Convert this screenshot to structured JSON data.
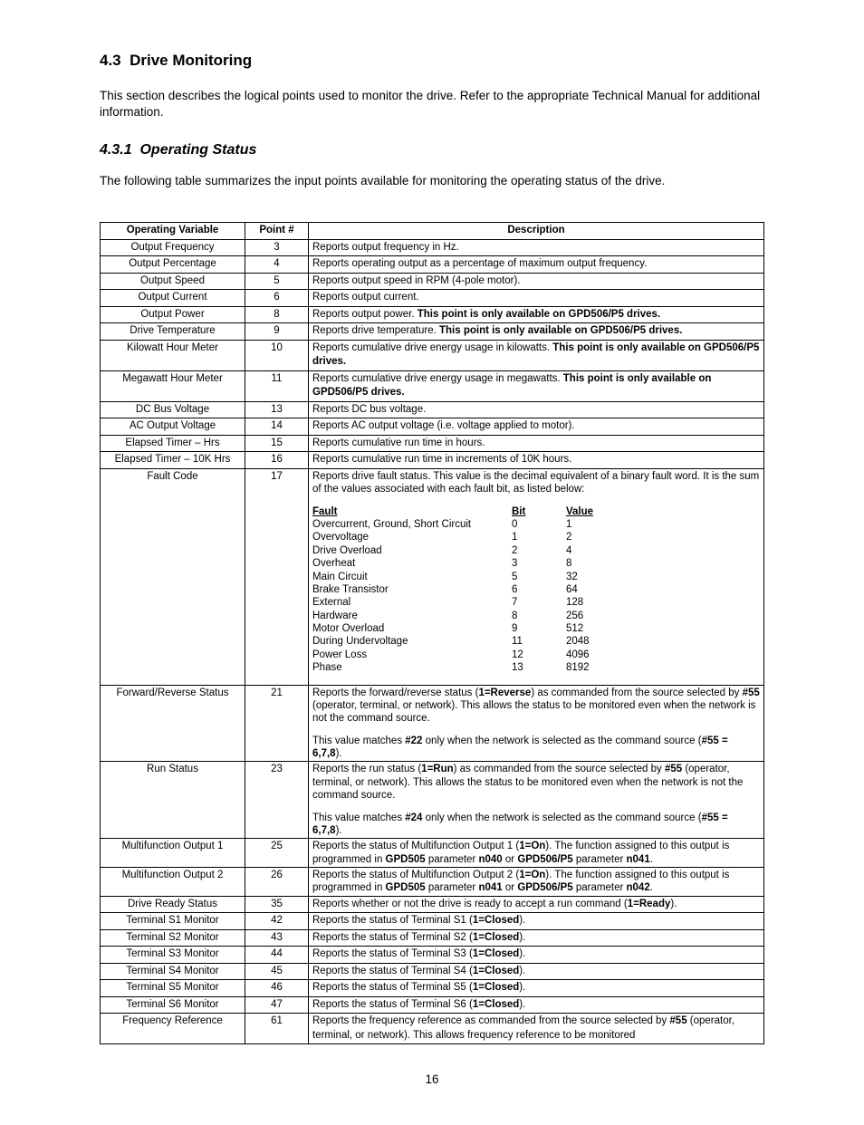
{
  "section_num": "4.3",
  "section_title": "Drive Monitoring",
  "section_intro": "This section describes the logical points used to monitor the drive.  Refer to the appropriate Technical Manual for additional information.",
  "sub_num": "4.3.1",
  "sub_title": "Operating Status",
  "sub_intro": "The following table summarizes the input points available for monitoring the operating status of the drive.",
  "headers": {
    "c1": "Operating Variable",
    "c2": "Point #",
    "c3": "Description"
  },
  "rows": [
    {
      "v": "Output Frequency",
      "p": "3",
      "d": "Reports output frequency in Hz."
    },
    {
      "v": "Output Percentage",
      "p": "4",
      "d": "Reports operating output as a percentage of maximum output frequency."
    },
    {
      "v": "Output Speed",
      "p": "5",
      "d": "Reports output speed in RPM (4-pole motor)."
    },
    {
      "v": "Output Current",
      "p": "6",
      "d": "Reports output current."
    },
    {
      "v": "Output Power",
      "p": "8",
      "d_pre": "Reports output power. ",
      "d_bold": "This point is only available on GPD506/P5 drives."
    },
    {
      "v": "Drive Temperature",
      "p": "9",
      "d_pre": "Reports drive temperature. ",
      "d_bold": "This point is only available on GPD506/P5 drives."
    },
    {
      "v": "Kilowatt Hour Meter",
      "p": "10",
      "d_pre": "Reports cumulative drive energy usage in kilowatts. ",
      "d_bold": "This point is only available on GPD506/P5 drives."
    },
    {
      "v": "Megawatt Hour Meter",
      "p": "11",
      "d_pre": "Reports cumulative drive energy usage in megawatts. ",
      "d_bold": "This point is only available on GPD506/P5 drives."
    },
    {
      "v": "DC Bus Voltage",
      "p": "13",
      "d": "Reports DC bus voltage."
    },
    {
      "v": "AC Output Voltage",
      "p": "14",
      "d": "Reports AC output voltage (i.e. voltage applied to motor)."
    },
    {
      "v": "Elapsed Timer – Hrs",
      "p": "15",
      "d": "Reports cumulative run time in hours."
    },
    {
      "v": "Elapsed Timer – 10K Hrs",
      "p": "16",
      "d": "Reports cumulative run time in increments of 10K hours."
    }
  ],
  "fault": {
    "v": "Fault Code",
    "p": "17",
    "intro": "Reports drive fault status.  This value is the decimal equivalent of a binary fault word.  It is the sum of the values associated with each fault bit, as listed below:",
    "hdr": {
      "a": "Fault",
      "b": "Bit",
      "c": "Value"
    },
    "items": [
      {
        "a": "Overcurrent, Ground, Short Circuit",
        "b": "0",
        "c": "1"
      },
      {
        "a": "Overvoltage",
        "b": "1",
        "c": "2"
      },
      {
        "a": "Drive Overload",
        "b": "2",
        "c": "4"
      },
      {
        "a": "Overheat",
        "b": "3",
        "c": "8"
      },
      {
        "a": "Main Circuit",
        "b": "5",
        "c": "32"
      },
      {
        "a": "Brake Transistor",
        "b": "6",
        "c": "64"
      },
      {
        "a": "External",
        "b": "7",
        "c": "128"
      },
      {
        "a": "Hardware",
        "b": "8",
        "c": "256"
      },
      {
        "a": "Motor Overload",
        "b": "9",
        "c": "512"
      },
      {
        "a": "During Undervoltage",
        "b": "11",
        "c": "2048"
      },
      {
        "a": "Power Loss",
        "b": "12",
        "c": "4096"
      },
      {
        "a": "Phase",
        "b": "13",
        "c": "8192"
      }
    ]
  },
  "fr": {
    "v": "Forward/Reverse Status",
    "p": "21",
    "l1a": "Reports the forward/reverse status (",
    "l1b": "1=Reverse",
    "l1c": ") as commanded from the source selected by ",
    "l1d": "#55",
    "l1e": " (operator, terminal, or network).  This allows the status to be monitored even when the network is not the command source.",
    "l2a": "This value matches ",
    "l2b": "#22",
    "l2c": " only when the network is selected as the command source (",
    "l2d": "#55 = 6,7,8",
    "l2e": ")."
  },
  "rs": {
    "v": "Run Status",
    "p": "23",
    "l1a": "Reports the run status (",
    "l1b": "1=Run",
    "l1c": ") as commanded from the source selected by ",
    "l1d": "#55",
    "l1e": " (operator, terminal, or network).  This allows the status to be monitored even when the network is not the command source.",
    "l2a": "This value matches ",
    "l2b": "#24",
    "l2c": " only when the network is selected as the command source (",
    "l2d": "#55 = 6,7,8",
    "l2e": ")."
  },
  "mf1": {
    "v": "Multifunction Output 1",
    "p": "25",
    "a": "Reports the status of Multifunction Output 1 (",
    "b": "1=On",
    "c": ").  The function assigned to this output is programmed in ",
    "d": "GPD505",
    "e": " parameter ",
    "f": "n040",
    "g": " or ",
    "h": "GPD506/P5",
    "i": " parameter ",
    "j": "n041",
    "k": "."
  },
  "mf2": {
    "v": "Multifunction Output 2",
    "p": "26",
    "a": "Reports the status of Multifunction Output 2 (",
    "b": "1=On",
    "c": ").  The function assigned to this output is programmed in ",
    "d": "GPD505",
    "e": " parameter ",
    "f": "n041",
    "g": " or ",
    "h": "GPD506/P5",
    "i": " parameter ",
    "j": "n042",
    "k": "."
  },
  "ready": {
    "v": "Drive Ready Status",
    "p": "35",
    "a": "Reports whether or not the drive is ready to accept a run command (",
    "b": "1=Ready",
    "c": ")."
  },
  "terms": [
    {
      "v": "Terminal S1 Monitor",
      "p": "42",
      "a": "Reports the status of Terminal S1 (",
      "b": "1=Closed",
      "c": ")."
    },
    {
      "v": "Terminal S2 Monitor",
      "p": "43",
      "a": "Reports the status of Terminal S2 (",
      "b": "1=Closed",
      "c": ")."
    },
    {
      "v": "Terminal S3 Monitor",
      "p": "44",
      "a": "Reports the status of Terminal S3 (",
      "b": "1=Closed",
      "c": ")."
    },
    {
      "v": "Terminal S4 Monitor",
      "p": "45",
      "a": "Reports the status of Terminal S4 (",
      "b": "1=Closed",
      "c": ")."
    },
    {
      "v": "Terminal S5 Monitor",
      "p": "46",
      "a": "Reports the status of Terminal S5 (",
      "b": "1=Closed",
      "c": ")."
    },
    {
      "v": "Terminal S6 Monitor",
      "p": "47",
      "a": "Reports the status of Terminal S6 (",
      "b": "1=Closed",
      "c": ")."
    }
  ],
  "freq": {
    "v": "Frequency Reference",
    "p": "61",
    "a": "Reports the frequency reference as commanded from the source selected by ",
    "b": "#55",
    "c": " (operator, terminal, or network).  This allows frequency reference to be monitored"
  },
  "page": "16"
}
